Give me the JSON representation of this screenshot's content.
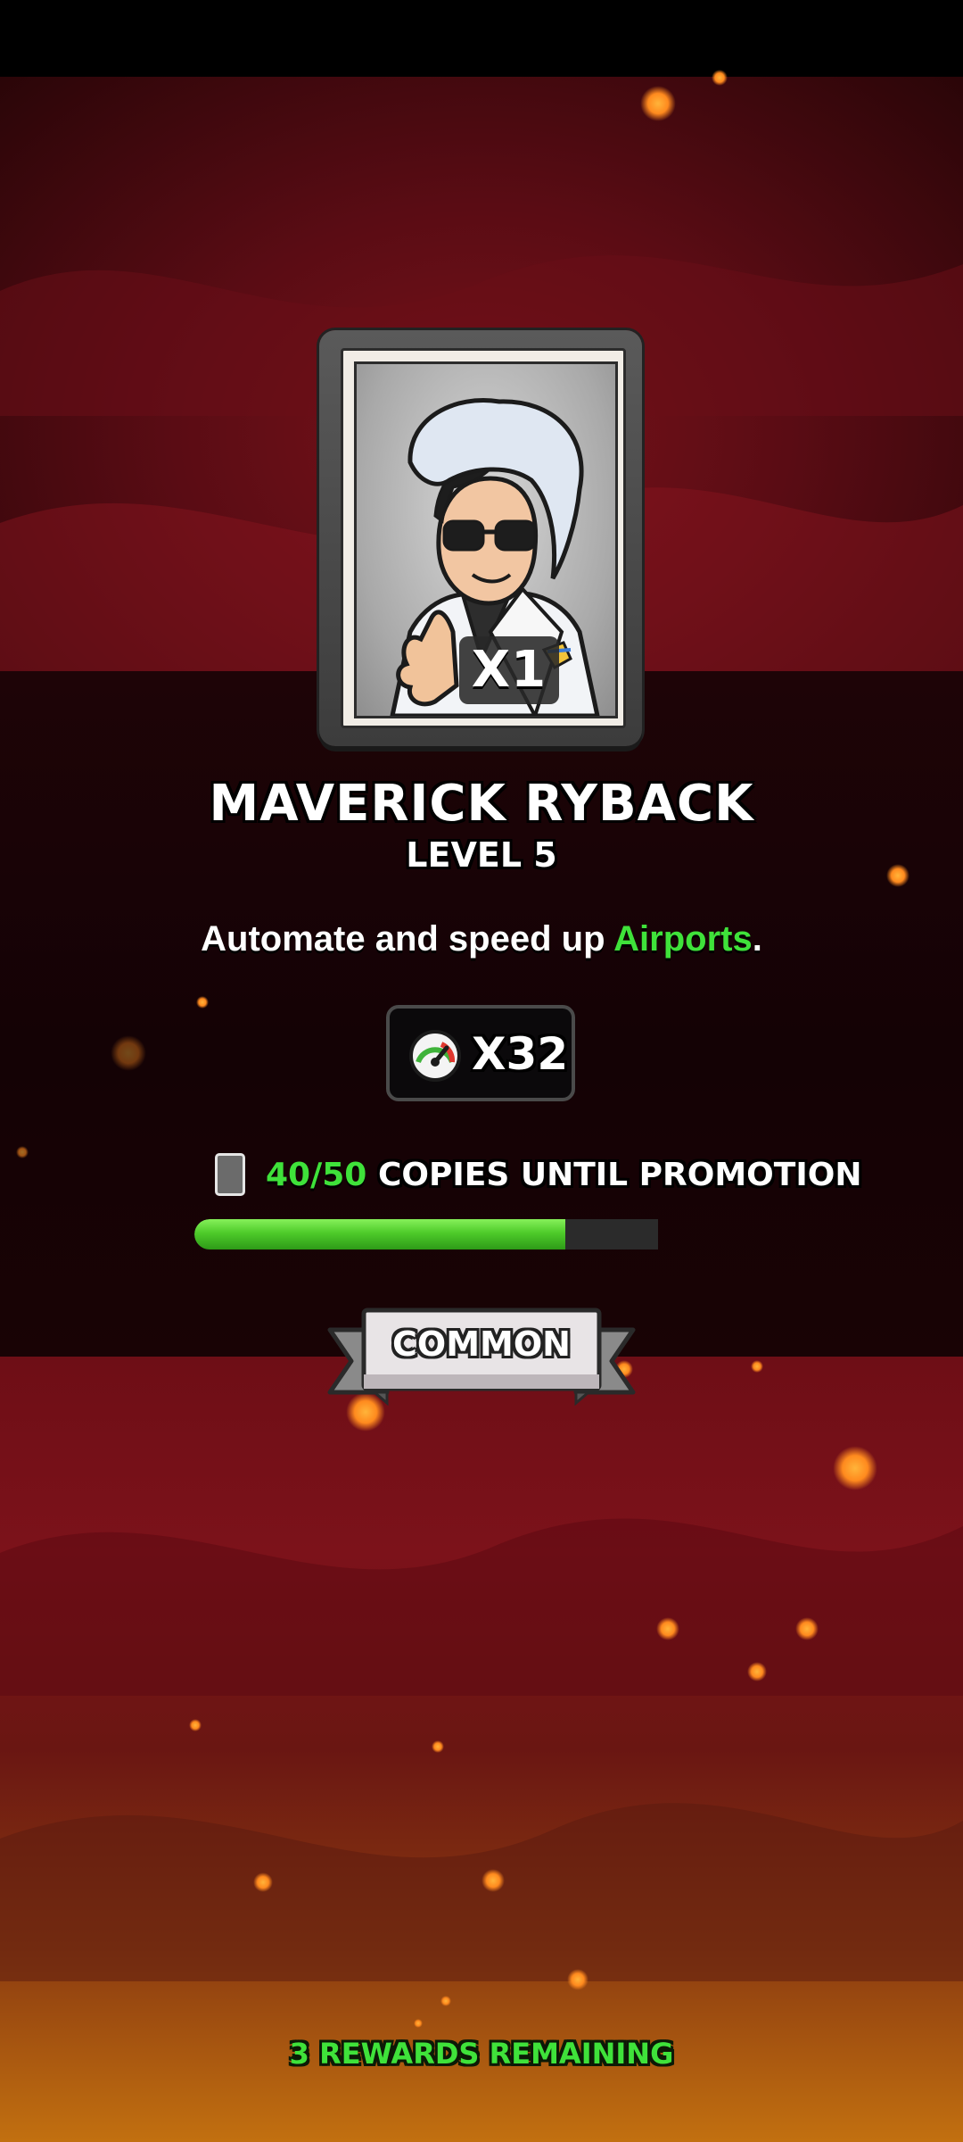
{
  "reward": {
    "card_count": "X1",
    "hero_name": "MAVERICK RYBACK",
    "level": "LEVEL 5",
    "description_prefix": "Automate and speed up ",
    "description_highlight": "Airports",
    "description_suffix": ".",
    "boost_value": "X32",
    "promotion_count": "40/50",
    "promotion_label": "COPIES UNTIL PROMOTION",
    "promotion_progress": 0.8,
    "rarity": "COMMON"
  },
  "footer": {
    "rewards_remaining": "3 REWARDS REMAINING"
  },
  "colors": {
    "highlight_green": "#3fe23a",
    "background_red": "#7a121a",
    "background_dark": "#140205"
  },
  "icons": {
    "boost": "speedometer-icon",
    "card": "card-icon"
  }
}
